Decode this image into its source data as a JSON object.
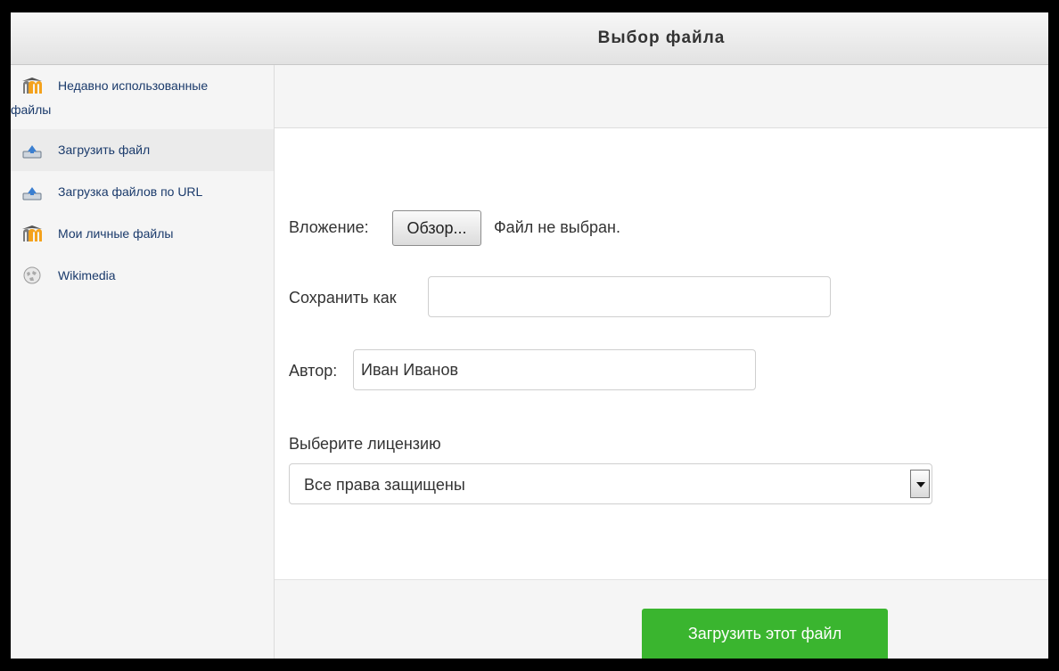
{
  "dialog": {
    "title": "Выбор файла"
  },
  "sidebar": {
    "items": [
      {
        "label_line1": "Недавно использованные",
        "label_line2": "файлы",
        "icon": "moodle-icon"
      },
      {
        "label": "Загрузить файл",
        "icon": "upload-icon",
        "active": true
      },
      {
        "label": "Загрузка файлов по URL",
        "icon": "upload-url-icon"
      },
      {
        "label": "Мои личные файлы",
        "icon": "moodle-icon"
      },
      {
        "label": "Wikimedia",
        "icon": "wikimedia-icon"
      }
    ]
  },
  "form": {
    "attachment_label": "Вложение:",
    "browse_label": "Обзор...",
    "no_file_text": "Файл не выбран.",
    "save_as_label": "Сохранить как",
    "save_as_value": "",
    "author_label": "Автор:",
    "author_value": "Иван Иванов",
    "license_label": "Выберите лицензию",
    "license_value": "Все права защищены"
  },
  "footer": {
    "upload_label": "Загрузить этот файл"
  },
  "colors": {
    "accent": "#3ab52f",
    "link": "#1a3a6b",
    "moodle_orange": "#f4a21d"
  }
}
